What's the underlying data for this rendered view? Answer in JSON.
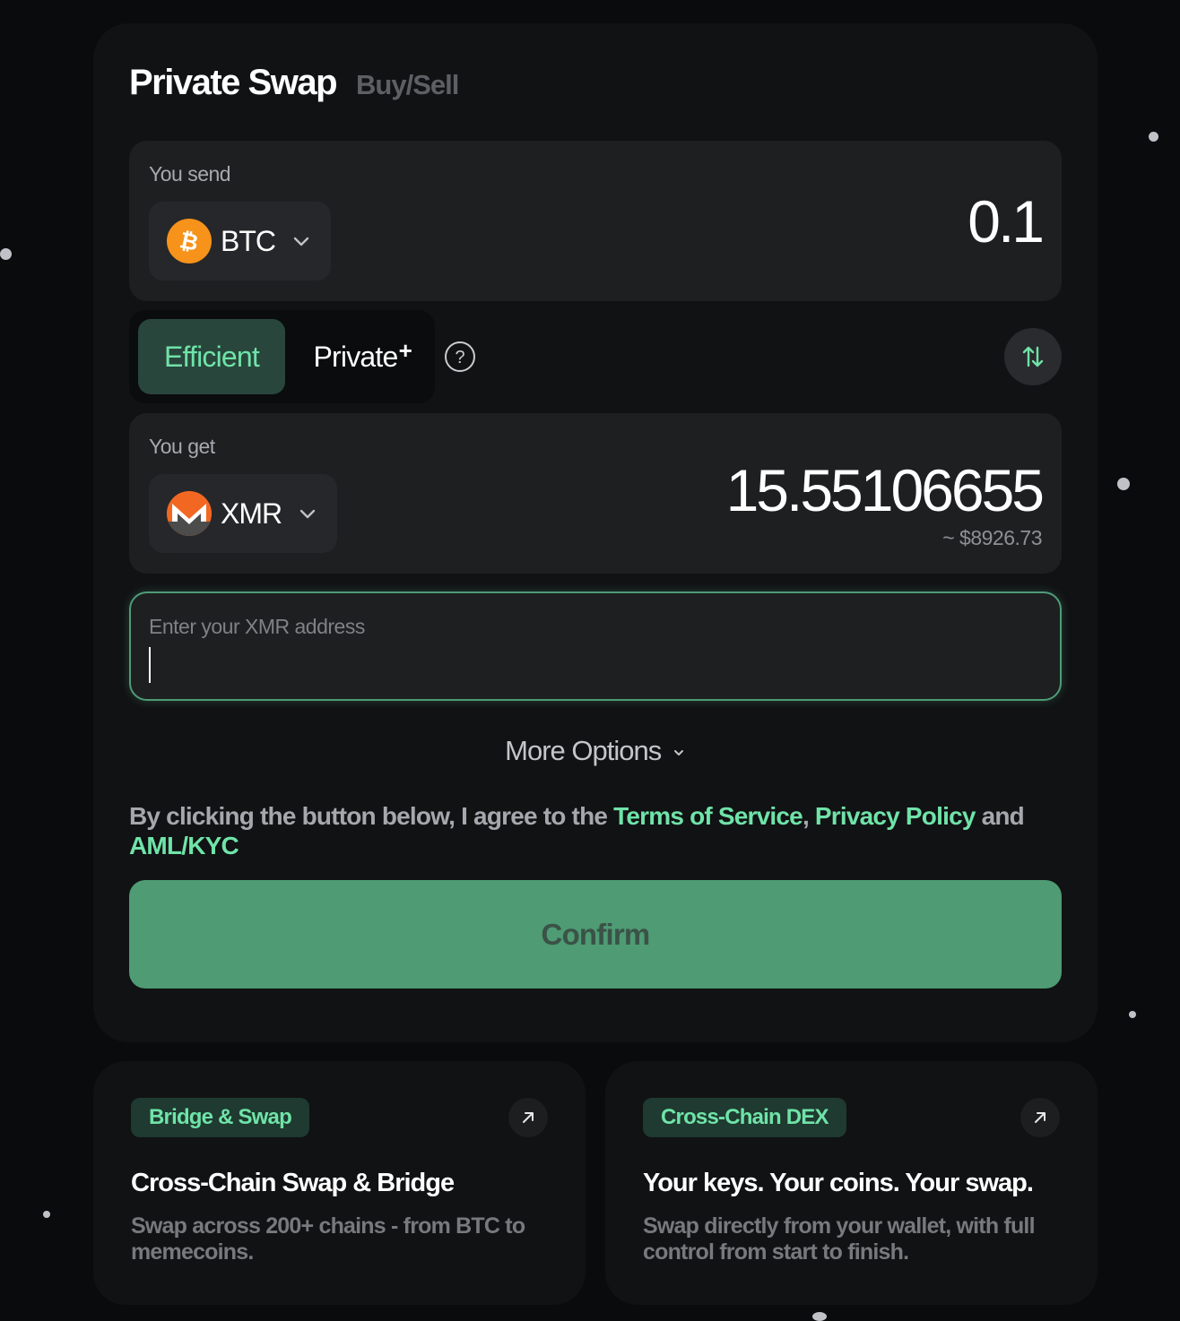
{
  "header": {
    "tab_active": "Private Swap",
    "tab_inactive": "Buy/Sell"
  },
  "send": {
    "label": "You send",
    "coin": "BTC",
    "coin_icon": "bitcoin-icon",
    "amount": "0.1"
  },
  "mode": {
    "efficient_label": "Efficient",
    "private_label": "Private",
    "private_badge": "+",
    "selected": "Efficient"
  },
  "receive": {
    "label": "You get",
    "coin": "XMR",
    "coin_icon": "monero-icon",
    "amount": "15.55106655",
    "usd_value": "~ $8926.73"
  },
  "address": {
    "placeholder": "Enter your XMR address",
    "value": ""
  },
  "more_options": {
    "label": "More Options"
  },
  "terms": {
    "prefix": "By clicking the button below, I agree to the ",
    "tos": "Terms of Service",
    "sep": ", ",
    "privacy": "Privacy Policy",
    "and": " and ",
    "aml": "AML/KYC"
  },
  "confirm": {
    "label": "Confirm"
  },
  "promos": [
    {
      "badge": "Bridge & Swap",
      "title": "Cross-Chain Swap & Bridge",
      "description": "Swap across 200+ chains - from BTC to memecoins."
    },
    {
      "badge": "Cross-Chain DEX",
      "title": "Your keys. Your coins. Your swap.",
      "description": "Swap directly from your wallet, with full control from start to finish."
    }
  ],
  "colors": {
    "background": "#0a0b0c",
    "card": "#111214",
    "panel": "#1e1f21",
    "accent": "#6fe3a8",
    "confirm": "#4e9b74",
    "btc": "#f7931a",
    "xmr": "#f26822"
  }
}
